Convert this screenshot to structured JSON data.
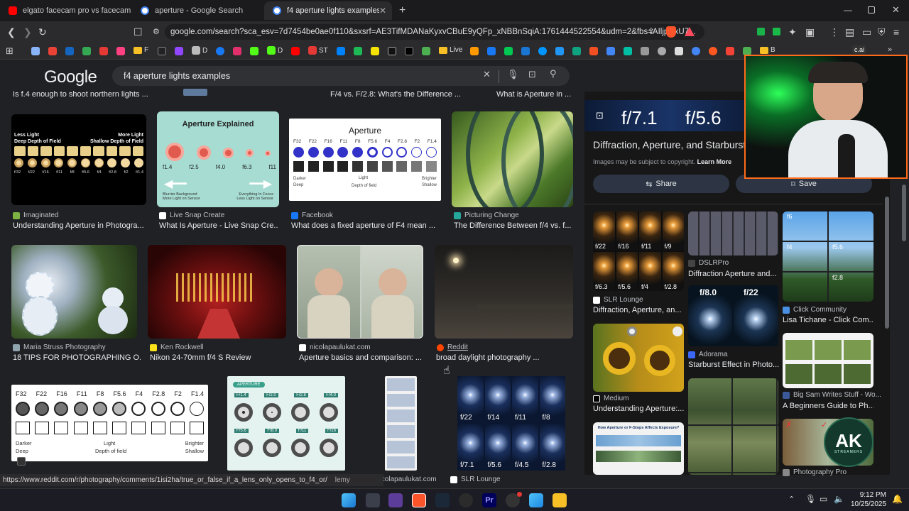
{
  "tabs": [
    {
      "title": "elgato facecam pro vs facecam 4k - Y",
      "icon": "youtube-icon"
    },
    {
      "title": "aperture - Google Search",
      "icon": "google-icon"
    },
    {
      "title": "f4 aperture lights examples - Goo",
      "icon": "google-icon"
    }
  ],
  "address": {
    "url": "google.com/search?sca_esv=7d7454be0ae0f110&sxsrf=AE3TifMDANaKyxvCBuE9yQFp_xNBBnSqiA:1761444522554&udm=2&fbs=AIljpHxU7..."
  },
  "bookmarks": [
    "F",
    "D",
    "D",
    "ST",
    "Live",
    "B",
    "c.ai"
  ],
  "google": {
    "logo": "Google",
    "query": "f4 aperture lights examples"
  },
  "top_captions": [
    "Is f.4 enough to shoot northern lights ...",
    "F/4 vs. F/2.8: What's the Difference ...",
    "What is Aperture in ..."
  ],
  "row1": [
    {
      "source": "Imaginated",
      "title": "Understanding Aperture in Photogra...",
      "img_text": {
        "left_a": "Less Light",
        "left_b": "Deep Depth of Field",
        "right_a": "More Light",
        "right_b": "Shallow Depth of Field",
        "stops": [
          "f/32",
          "f/22",
          "f/16",
          "f/11",
          "f/8",
          "f/5.6",
          "f/4",
          "f/2.8",
          "f/2",
          "f/1.4"
        ]
      }
    },
    {
      "source": "Live Snap Create",
      "title": "What Is Aperture - Live Snap Cre...",
      "img_text": {
        "heading": "Aperture Explained",
        "stops": [
          "f1.4",
          "f2.5",
          "f4.0",
          "f6.3",
          "f11"
        ],
        "left_note": "Blurrier Background More Light on Sensor",
        "right_note": "Everything In Focus Less Light on Sensor"
      }
    },
    {
      "source": "Facebook",
      "title": "What does a fixed aperture of F4 mean ...",
      "img_text": {
        "heading": "Aperture",
        "stops": [
          "F32",
          "F22",
          "F16",
          "F11",
          "F8",
          "F5.6",
          "F4",
          "F2.8",
          "F2",
          "F1.4"
        ],
        "darker": "Darker",
        "deep": "Deep",
        "light": "Light",
        "dof": "Depth of field",
        "brighter": "Brighter",
        "shallow": "Shallow"
      }
    },
    {
      "source": "Picturing Change",
      "title": "The Difference Between f/4 vs. f..."
    }
  ],
  "row2": [
    {
      "source": "Maria Struss Photography",
      "title": "18 TIPS FOR PHOTOGRAPHING O..."
    },
    {
      "source": "Ken Rockwell",
      "title": "Nikon 24-70mm f/4 S Review"
    },
    {
      "source": "nicolapaulukat.com",
      "title": "Aperture basics and comparison: ..."
    },
    {
      "source": "Reddit",
      "title": "broad daylight photography ..."
    }
  ],
  "row3": [
    {
      "img_text": {
        "stops": [
          "F32",
          "F22",
          "F16",
          "F11",
          "F8",
          "F5.6",
          "F4",
          "F2.8",
          "F2",
          "F1.4"
        ],
        "darker": "Darker",
        "deep": "Deep",
        "light": "Light",
        "dof": "Depth of field",
        "brighter": "Brighter",
        "shallow": "Shallow"
      }
    },
    {
      "img_text": {
        "badge": "APERTURE",
        "stops_a": [
          "F/1.4",
          "F/2.0",
          "F/2.8",
          "F/4.0"
        ],
        "stops_b": [
          "F/5.6",
          "F/8.0",
          "F/11",
          "F/16"
        ]
      }
    },
    {
      "source": "nicolapaulukat.com"
    },
    {
      "source": "SLR Lounge",
      "img_text": {
        "stops": [
          "f/22",
          "f/14",
          "f/11",
          "f/8",
          "f/7.1",
          "f/5.6",
          "f/4.5",
          "f/2.8"
        ]
      }
    }
  ],
  "side_panel": {
    "banner_stops": [
      "f/7.1",
      "f/5.6"
    ],
    "title": "Diffraction, Aperture, and Starburst",
    "copyright": "Images may be subject to copyright.",
    "learn_more": "Learn More",
    "share": "Share",
    "save": "Save",
    "related": [
      {
        "source": "SLR Lounge",
        "title": "Diffraction, Aperture, an...",
        "img_text": [
          "f/22",
          "f/16",
          "f/11",
          "f/9",
          "f/6.3",
          "f/5.6",
          "f/4",
          "f/2.8"
        ]
      },
      {
        "source": "DSLRPro",
        "title": "Diffraction Aperture and..."
      },
      {
        "source": "Click Community",
        "title": "Lisa Tichane - Click Com...",
        "img_text": [
          "f6",
          "f4",
          "f5.6",
          "f2.8"
        ]
      },
      {
        "source": "Adorama",
        "title": "Starburst Effect in Photo...",
        "img_text": [
          "f/8.0",
          "f/22"
        ]
      },
      {
        "source": "Medium",
        "title": "Understanding Aperture:..."
      },
      {
        "source": "Big Sam Writes Stuff - Wo...",
        "title": "A Beginners Guide to Ph..."
      },
      {
        "img_text": [
          "How Aperture or F-Stops Affects Exposure?"
        ]
      },
      {
        "source": "Photography Pro"
      }
    ]
  },
  "status": {
    "link": "https://www.reddit.com/r/photography/comments/1isi2ha/true_or_false_if_a_lens_only_opens_to_f4_or/",
    "suffix": "lemy"
  },
  "taskbar": {
    "time": "9:12 PM",
    "date": "10/25/2025"
  },
  "watermark": {
    "text": "AK",
    "subtext": "STREAMERS"
  }
}
